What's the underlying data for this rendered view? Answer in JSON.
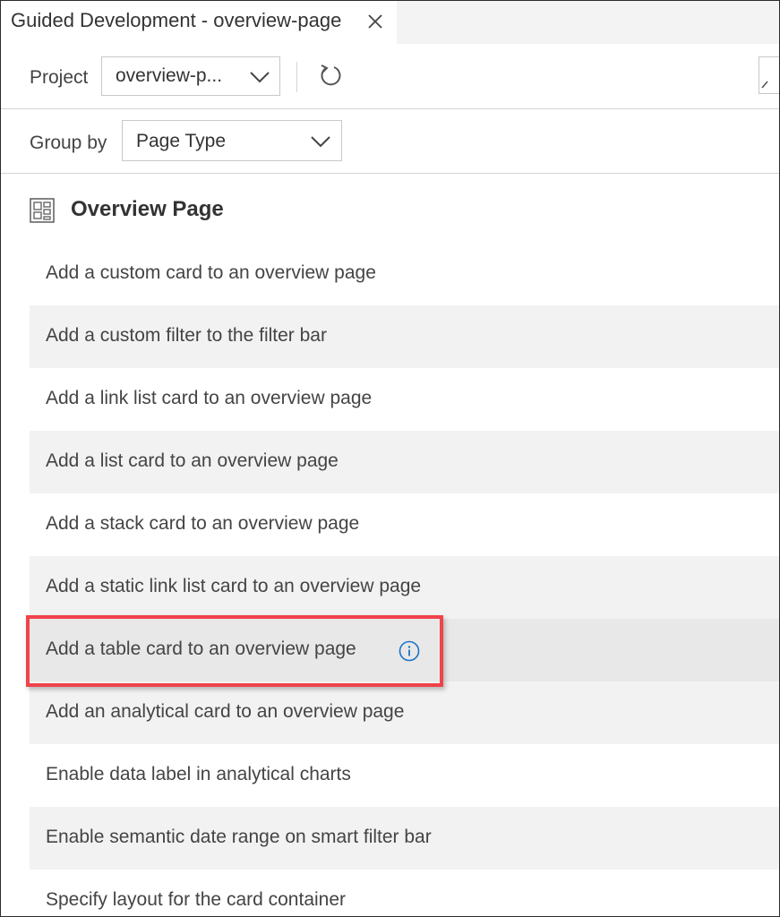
{
  "tab": {
    "title": "Guided Development - overview-page",
    "close_icon": "close-icon"
  },
  "toolbar": {
    "project_label": "Project",
    "project_value": "overview-p...",
    "refresh_icon": "refresh-icon"
  },
  "group_by": {
    "label": "Group by",
    "value": "Page Type"
  },
  "section": {
    "icon": "layout-grid-icon",
    "title": "Overview Page"
  },
  "items": [
    {
      "label": "Add a custom card to an overview page"
    },
    {
      "label": "Add a custom filter to the filter bar"
    },
    {
      "label": "Add a link list card to an overview page"
    },
    {
      "label": "Add a list card to an overview page"
    },
    {
      "label": "Add a stack card to an overview page"
    },
    {
      "label": "Add a static link list card to an overview page"
    },
    {
      "label": "Add a table card to an overview page",
      "highlighted": true,
      "info_icon": "info-icon"
    },
    {
      "label": "Add an analytical card to an overview page"
    },
    {
      "label": "Enable data label in analytical charts"
    },
    {
      "label": "Enable semantic date range on smart filter bar"
    },
    {
      "label": "Specify layout for the card container"
    }
  ],
  "colors": {
    "highlight_border": "#f0434a",
    "info_icon": "#1a73c7",
    "row_alt": "#f2f2f2",
    "row_hover": "#e8e8e8"
  }
}
